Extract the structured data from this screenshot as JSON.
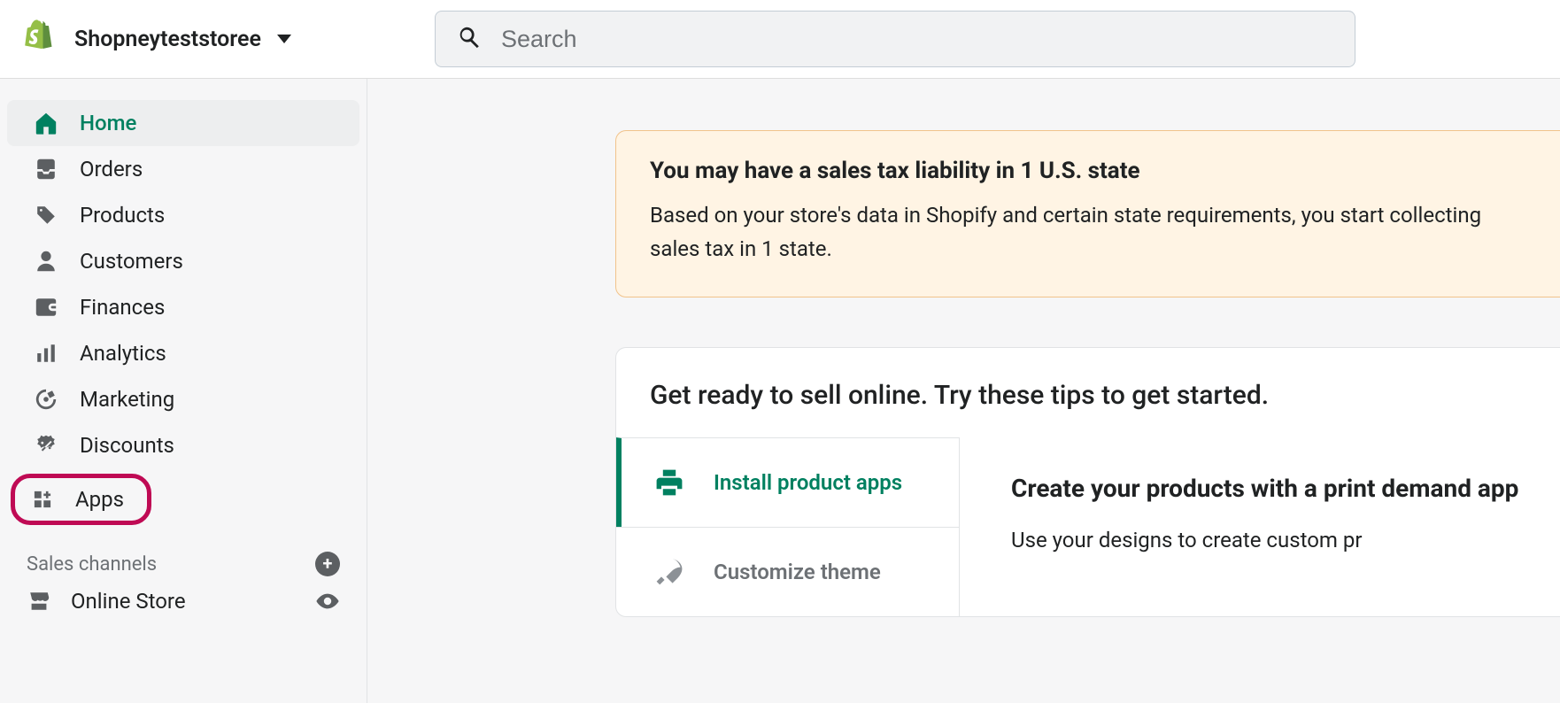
{
  "header": {
    "store_name": "Shopneyteststoree",
    "search_placeholder": "Search"
  },
  "sidebar": {
    "items": [
      {
        "id": "home",
        "label": "Home",
        "active": true
      },
      {
        "id": "orders",
        "label": "Orders"
      },
      {
        "id": "products",
        "label": "Products"
      },
      {
        "id": "customers",
        "label": "Customers"
      },
      {
        "id": "finances",
        "label": "Finances"
      },
      {
        "id": "analytics",
        "label": "Analytics"
      },
      {
        "id": "marketing",
        "label": "Marketing"
      },
      {
        "id": "discounts",
        "label": "Discounts"
      },
      {
        "id": "apps",
        "label": "Apps",
        "highlighted": true
      }
    ],
    "channels_header": "Sales channels",
    "channels": [
      {
        "id": "online-store",
        "label": "Online Store"
      }
    ]
  },
  "banner": {
    "title": "You may have a sales tax liability in 1 U.S. state",
    "body": "Based on your store's data in Shopify and certain state requirements, you start collecting sales tax in 1 state."
  },
  "card": {
    "header": "Get ready to sell online. Try these tips to get started.",
    "tips": [
      {
        "id": "install-apps",
        "label": "Install product apps",
        "active": true
      },
      {
        "id": "customize-theme",
        "label": "Customize theme",
        "active": false
      }
    ],
    "detail_title": "Create your products with a print demand app",
    "detail_desc": "Use your designs to create custom pr"
  }
}
